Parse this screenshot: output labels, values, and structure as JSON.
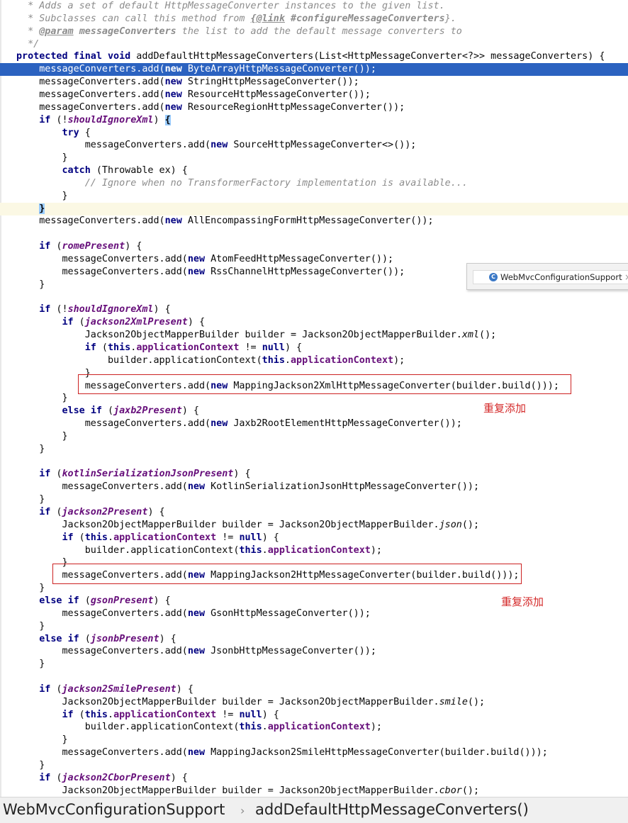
{
  "editor": {
    "lines": [
      "  * Adds a set of default HttpMessageConverter instances to the given list.",
      "  * Subclasses can call this method from {@link #configureMessageConverters}.",
      "  * @param messageConverters the list to add the default message converters to",
      "  */",
      "protected final void addDefaultHttpMessageConverters(List<HttpMessageConverter<?>> messageConverters) {",
      "    messageConverters.add(new ByteArrayHttpMessageConverter());",
      "    messageConverters.add(new StringHttpMessageConverter());",
      "    messageConverters.add(new ResourceHttpMessageConverter());",
      "    messageConverters.add(new ResourceRegionHttpMessageConverter());",
      "    if (!shouldIgnoreXml) {",
      "        try {",
      "            messageConverters.add(new SourceHttpMessageConverter<>());",
      "        }",
      "        catch (Throwable ex) {",
      "            // Ignore when no TransformerFactory implementation is available...",
      "        }",
      "    }",
      "    messageConverters.add(new AllEncompassingFormHttpMessageConverter());",
      "",
      "    if (romePresent) {",
      "        messageConverters.add(new AtomFeedHttpMessageConverter());",
      "        messageConverters.add(new RssChannelHttpMessageConverter());",
      "    }",
      "",
      "    if (!shouldIgnoreXml) {",
      "        if (jackson2XmlPresent) {",
      "            Jackson2ObjectMapperBuilder builder = Jackson2ObjectMapperBuilder.xml();",
      "            if (this.applicationContext != null) {",
      "                builder.applicationContext(this.applicationContext);",
      "            }",
      "            messageConverters.add(new MappingJackson2XmlHttpMessageConverter(builder.build()));",
      "        }",
      "        else if (jaxb2Present) {",
      "            messageConverters.add(new Jaxb2RootElementHttpMessageConverter());",
      "        }",
      "    }",
      "",
      "    if (kotlinSerializationJsonPresent) {",
      "        messageConverters.add(new KotlinSerializationJsonHttpMessageConverter());",
      "    }",
      "    if (jackson2Present) {",
      "        Jackson2ObjectMapperBuilder builder = Jackson2ObjectMapperBuilder.json();",
      "        if (this.applicationContext != null) {",
      "            builder.applicationContext(this.applicationContext);",
      "        }",
      "        messageConverters.add(new MappingJackson2HttpMessageConverter(builder.build()));",
      "    }",
      "    else if (gsonPresent) {",
      "        messageConverters.add(new GsonHttpMessageConverter());",
      "    }",
      "    else if (jsonbPresent) {",
      "        messageConverters.add(new JsonbHttpMessageConverter());",
      "    }",
      "",
      "    if (jackson2SmilePresent) {",
      "        Jackson2ObjectMapperBuilder builder = Jackson2ObjectMapperBuilder.smile();",
      "        if (this.applicationContext != null) {",
      "            builder.applicationContext(this.applicationContext);",
      "        }",
      "        messageConverters.add(new MappingJackson2SmileHttpMessageConverter(builder.build()));",
      "    }",
      "    if (jackson2CborPresent) {",
      "        Jackson2ObjectMapperBuilder builder = Jackson2ObjectMapperBuilder.cbor();"
    ],
    "selected_line": 5,
    "caret_line": 16
  },
  "annotations": [
    {
      "text": "重复添加"
    },
    {
      "text": "重复添加"
    }
  ],
  "popup": {
    "label": "WebMvcConfigurationSupport",
    "close": "×",
    "icon": "class-icon"
  },
  "breadcrumb": {
    "items": [
      "WebMvcConfigurationSupport",
      "addDefaultHttpMessageConverters()"
    ],
    "separator": "›"
  },
  "colors": {
    "keyword": "#000080",
    "field": "#660e7a",
    "comment": "#8c8c8c",
    "selection": "#2b62c0",
    "annotation": "#d42a2a"
  }
}
